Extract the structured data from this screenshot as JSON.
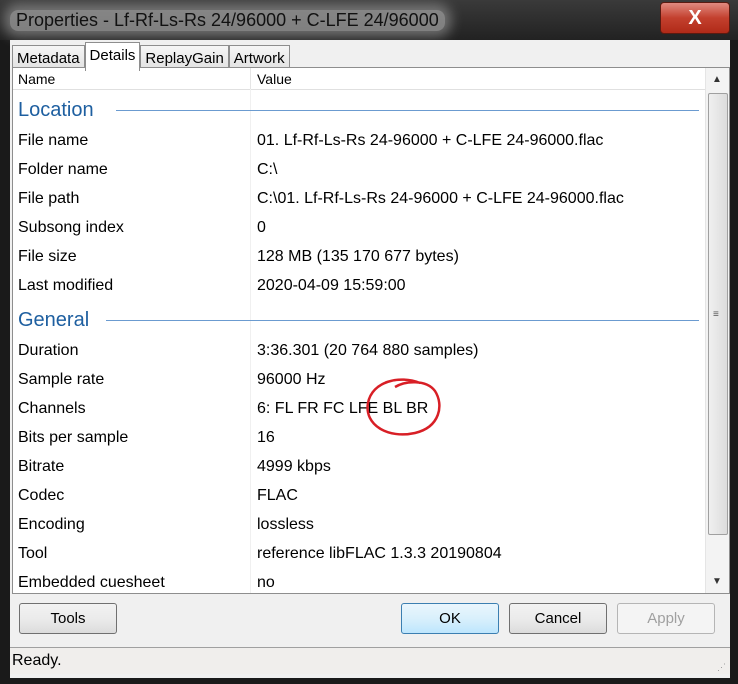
{
  "window": {
    "title": "Properties - Lf-Rf-Ls-Rs 24/96000 + C-LFE 24/96000",
    "close": "X"
  },
  "tabs": [
    "Metadata",
    "Details",
    "ReplayGain",
    "Artwork"
  ],
  "columns": {
    "name": "Name",
    "value": "Value"
  },
  "groups": {
    "location": {
      "label": "Location",
      "rows": [
        {
          "name": "File name",
          "value": "01. Lf-Rf-Ls-Rs 24-96000 + C-LFE 24-96000.flac"
        },
        {
          "name": "Folder name",
          "value": "C:\\"
        },
        {
          "name": "File path",
          "value": "C:\\01. Lf-Rf-Ls-Rs 24-96000 + C-LFE 24-96000.flac"
        },
        {
          "name": "Subsong index",
          "value": "0"
        },
        {
          "name": "File size",
          "value": "128 MB (135 170 677 bytes)"
        },
        {
          "name": "Last modified",
          "value": "2020-04-09 15:59:00"
        }
      ]
    },
    "general": {
      "label": "General",
      "rows": [
        {
          "name": "Duration",
          "value": "3:36.301 (20 764 880 samples)"
        },
        {
          "name": "Sample rate",
          "value": "96000 Hz"
        },
        {
          "name": "Channels",
          "value": "6: FL FR FC LFE BL BR"
        },
        {
          "name": "Bits per sample",
          "value": "16"
        },
        {
          "name": "Bitrate",
          "value": "4999 kbps"
        },
        {
          "name": "Codec",
          "value": "FLAC"
        },
        {
          "name": "Encoding",
          "value": "lossless"
        },
        {
          "name": "Tool",
          "value": "reference libFLAC 1.3.3 20190804"
        },
        {
          "name": "Embedded cuesheet",
          "value": "no"
        }
      ]
    }
  },
  "buttons": {
    "tools": "Tools",
    "ok": "OK",
    "cancel": "Cancel",
    "apply": "Apply"
  },
  "status": "Ready.",
  "annotation_color": "#d81f26"
}
